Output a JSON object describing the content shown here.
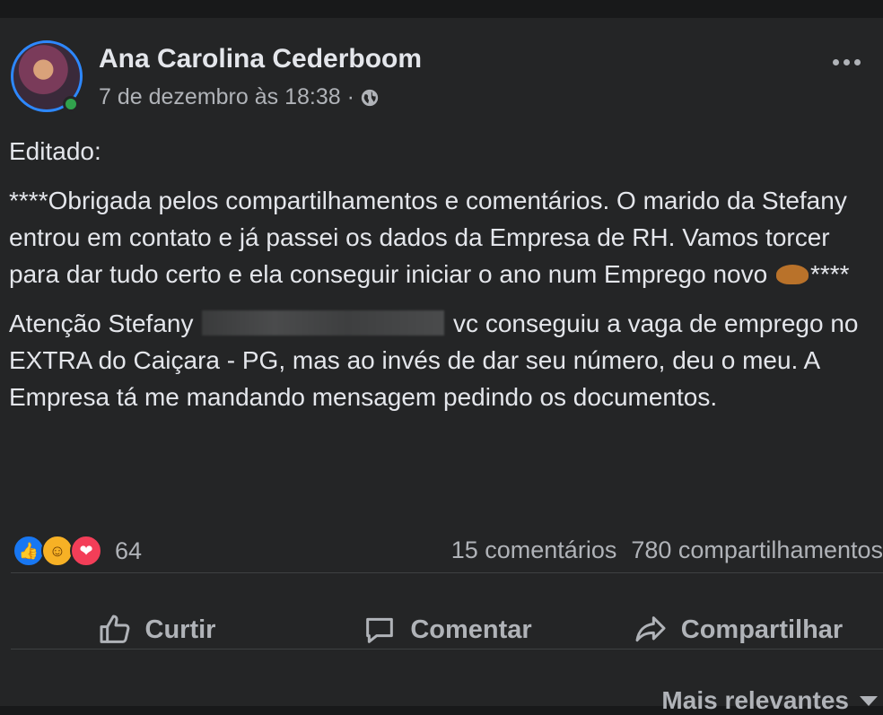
{
  "post": {
    "author": "Ana Carolina Cederboom",
    "timestamp": "7 de dezembro às 18:38 ·",
    "paragraphs": {
      "p1": "Editado:",
      "p2": "****Obrigada pelos compartilhamentos e comentários. O marido da Stefany entrou em contato e já passei os dados da Empresa de RH. Vamos torcer para dar tudo certo e ela conseguir iniciar o ano num Emprego novo",
      "p2_end": "****",
      "p3_start": "Atenção Stefany",
      "p3_end": "vc conseguiu a vaga de emprego no  EXTRA do Caiçara - PG, mas ao invés de dar seu número, deu o meu. A Empresa tá me mandando mensagem pedindo os documentos."
    }
  },
  "reactions": {
    "icons": [
      "like-icon",
      "haha-icon",
      "love-icon"
    ],
    "count": "64",
    "comments": "15 comentários",
    "shares": "780 compartilhamentos"
  },
  "actions": {
    "like": "Curtir",
    "comment": "Comentar",
    "share": "Compartilhar"
  },
  "sort": {
    "label": "Mais relevantes"
  },
  "colors": {
    "background": "#18191a",
    "card": "#242526",
    "text": "#e4e6eb",
    "secondary_text": "#b0b3b8",
    "like": "#1877f2",
    "love": "#f33e58",
    "haha": "#f7b125",
    "online": "#31a24c"
  }
}
